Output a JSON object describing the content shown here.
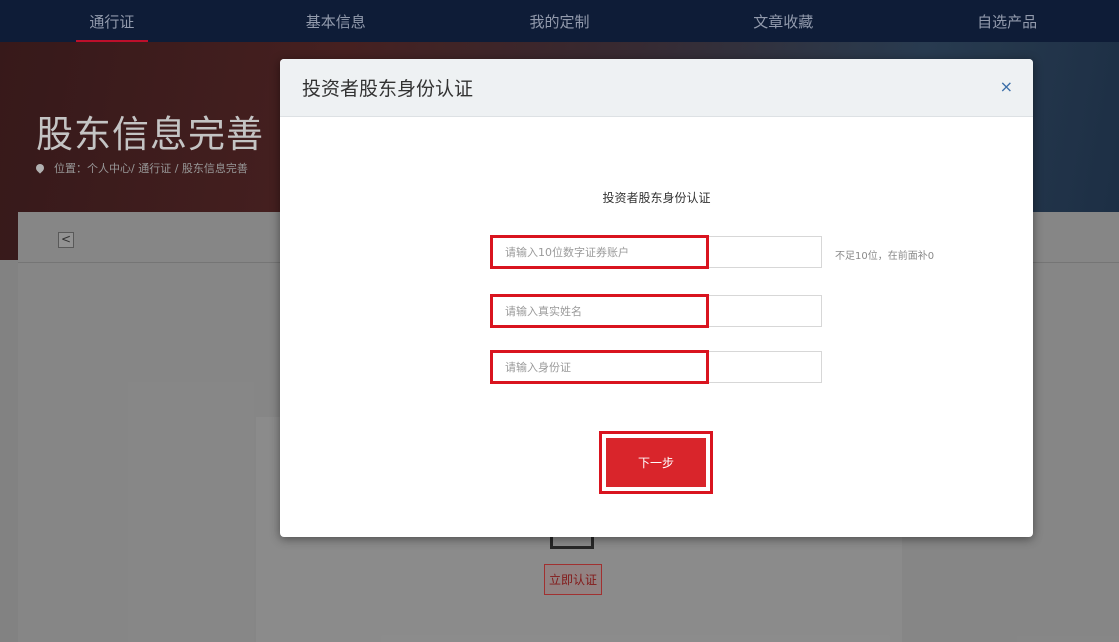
{
  "nav": {
    "items": [
      {
        "label": "通行证",
        "active": true
      },
      {
        "label": "基本信息",
        "active": false
      },
      {
        "label": "我的定制",
        "active": false
      },
      {
        "label": "文章收藏",
        "active": false
      },
      {
        "label": "自选产品",
        "active": false
      }
    ],
    "active_color": "#c8102e"
  },
  "hero": {
    "title": "股东信息完善",
    "breadcrumb": "位置：个人中心/ 通行证 / 股东信息完善"
  },
  "content": {
    "back_icon": "chevron-left-icon",
    "back_glyph": "<",
    "card_button_label": "立即认证"
  },
  "modal": {
    "title": "投资者股东身份认证",
    "close_glyph": "×",
    "subtitle": "投资者股东身份认证",
    "fields": {
      "account": {
        "placeholder": "请输入10位数字证券账户",
        "value": ""
      },
      "name": {
        "placeholder": "请输入真实姓名",
        "value": ""
      },
      "id_card": {
        "placeholder": "请输入身份证",
        "value": ""
      }
    },
    "account_hint": "不足10位，在前面补0",
    "next_label": "下一步",
    "highlight_color": "#d9141f",
    "button_color": "#d9252b"
  }
}
